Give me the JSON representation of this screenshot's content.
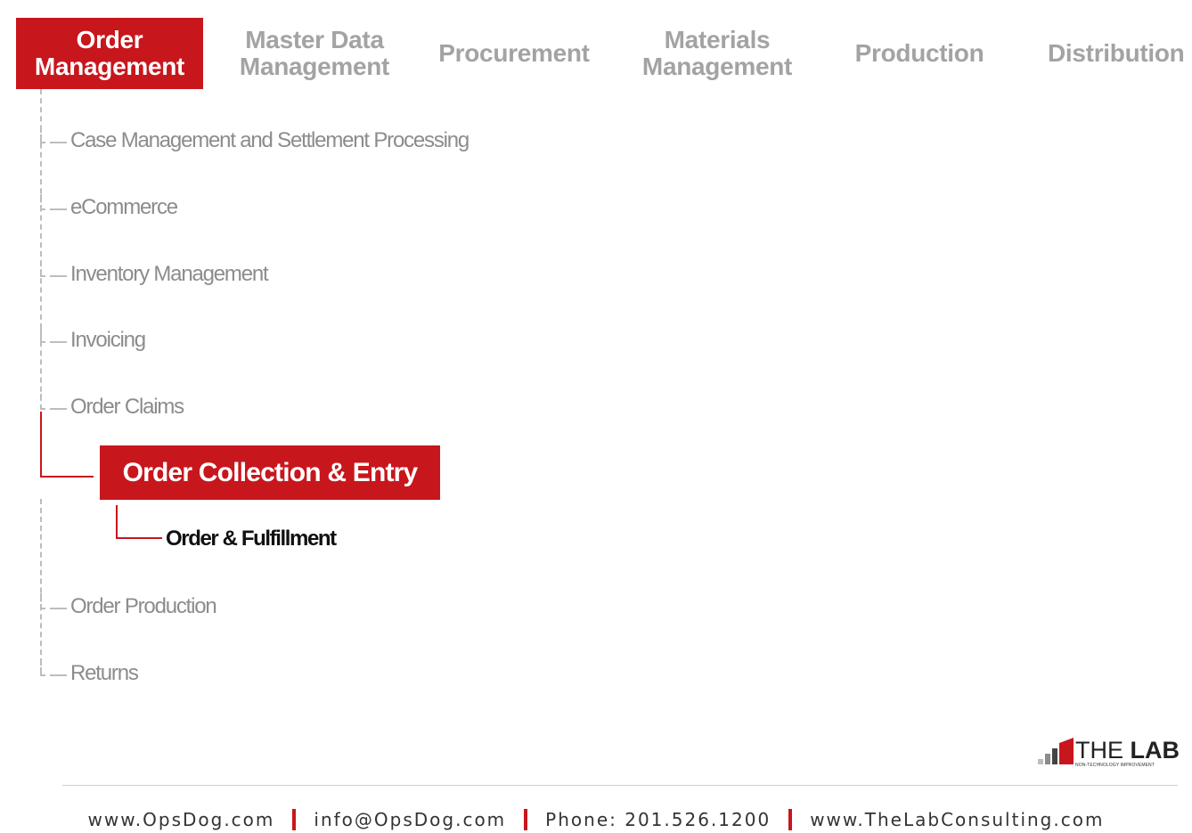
{
  "nav": {
    "tabs": [
      {
        "label": "Order\nManagement",
        "active": true
      },
      {
        "label": "Master Data\nManagement",
        "active": false
      },
      {
        "label": "Procurement",
        "active": false
      },
      {
        "label": "Materials\nManagement",
        "active": false
      },
      {
        "label": "Production",
        "active": false
      },
      {
        "label": "Distribution",
        "active": false
      }
    ]
  },
  "tree": {
    "items": [
      "Case Management and Settlement Processing",
      "eCommerce",
      "Inventory Management",
      "Invoicing",
      "Order Claims",
      "Order Production",
      "Returns"
    ],
    "selected": "Order Collection & Entry",
    "child": "Order & Fulfillment"
  },
  "logo": {
    "text_light": "THE ",
    "text_bold": "LAB",
    "tagline": "NON-TECHNOLOGY IMPROVEMENT"
  },
  "footer": {
    "website": "www.OpsDog.com",
    "email": "info@OpsDog.com",
    "phone": "Phone: 201.526.1200",
    "website2": "www.TheLabConsulting.com"
  },
  "colors": {
    "accent": "#c8161d",
    "muted": "#a3a3a3"
  }
}
